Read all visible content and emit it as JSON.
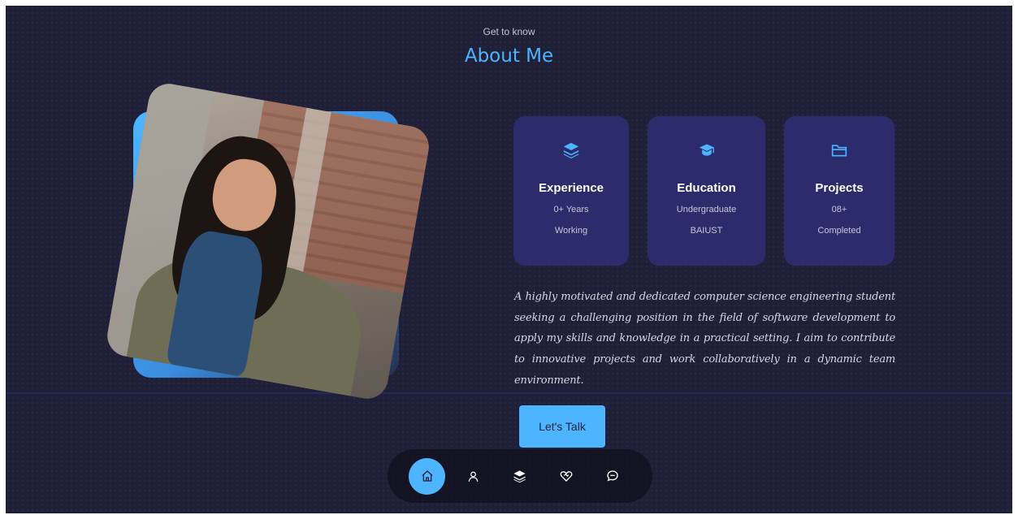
{
  "header": {
    "subtitle": "Get to know",
    "title": "About Me"
  },
  "photo": {
    "alt": "Portrait photo"
  },
  "cards": [
    {
      "icon": "layers-icon",
      "title": "Experience",
      "line1": "0+ Years",
      "line2": "Working"
    },
    {
      "icon": "graduation-cap-icon",
      "title": "Education",
      "line1": "Undergraduate",
      "line2": "BAIUST"
    },
    {
      "icon": "folder-icon",
      "title": "Projects",
      "line1": "08+",
      "line2": "Completed"
    }
  ],
  "bio": "A highly motivated and dedicated computer science engineering student seeking a challenging position in the field of software development to apply my skills and knowledge in a practical setting. I aim to contribute to innovative projects and work collaboratively in a dynamic team environment.",
  "cta": {
    "label": "Let's Talk"
  },
  "nav": {
    "items": [
      {
        "icon": "home-icon",
        "active": true
      },
      {
        "icon": "user-icon",
        "active": false
      },
      {
        "icon": "layers-icon",
        "active": false
      },
      {
        "icon": "heart-handshake-icon",
        "active": false
      },
      {
        "icon": "message-icon",
        "active": false
      }
    ]
  },
  "colors": {
    "background": "#1f1f38",
    "accent": "#4db5ff",
    "card": "#2c2c6c",
    "text": "#ffffff"
  }
}
